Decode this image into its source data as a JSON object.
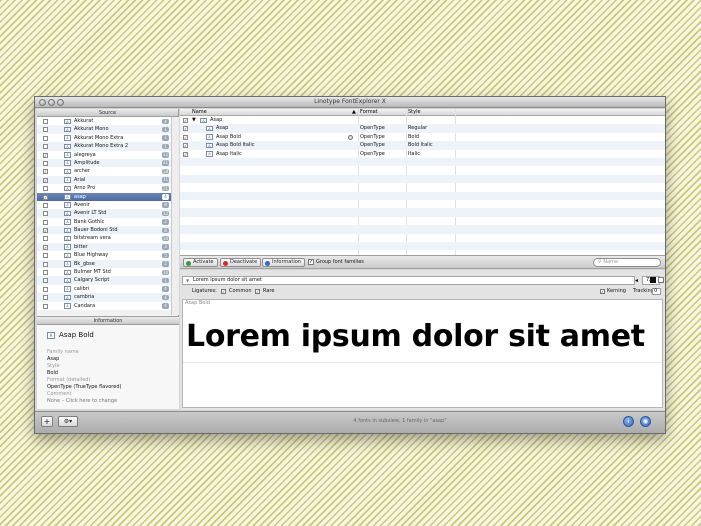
{
  "window": {
    "title": "Linotype FontExplorer X"
  },
  "sidebar": {
    "header": "Source",
    "fonts": [
      {
        "name": "Akkurat",
        "count": "4",
        "checked": false
      },
      {
        "name": "Akkurat Mono",
        "count": "1",
        "checked": false
      },
      {
        "name": "Akkurat Mono Extra",
        "count": "1",
        "checked": false
      },
      {
        "name": "Akkurat Mono Extra 2",
        "count": "1",
        "checked": false
      },
      {
        "name": "alegreya",
        "count": "12",
        "checked": true
      },
      {
        "name": "Amplitude",
        "count": "21",
        "checked": false
      },
      {
        "name": "archer",
        "count": "18",
        "checked": true
      },
      {
        "name": "Arial",
        "count": "11",
        "checked": true
      },
      {
        "name": "Arno Pro",
        "count": "21",
        "checked": false
      },
      {
        "name": "asap",
        "count": "4",
        "checked": true,
        "selected": true
      },
      {
        "name": "Avenir",
        "count": "8",
        "checked": false
      },
      {
        "name": "Avenir LT Std",
        "count": "12",
        "checked": false
      },
      {
        "name": "Bank Gothic",
        "count": "2",
        "checked": false
      },
      {
        "name": "Bauer Bodoni Std",
        "count": "8",
        "checked": true
      },
      {
        "name": "bitstream vera",
        "count": "10",
        "checked": false
      },
      {
        "name": "bitter",
        "count": "3",
        "checked": true
      },
      {
        "name": "Blue Highway",
        "count": "5",
        "checked": false
      },
      {
        "name": "Bk_gbse",
        "count": "2",
        "checked": false
      },
      {
        "name": "Bulmer MT Std",
        "count": "10",
        "checked": false
      },
      {
        "name": "Calgary Script",
        "count": "1",
        "checked": false
      },
      {
        "name": "calibri",
        "count": "4",
        "checked": false
      },
      {
        "name": "cambria",
        "count": "4",
        "checked": false
      },
      {
        "name": "Candara",
        "count": "4",
        "checked": false
      }
    ]
  },
  "information": {
    "header": "Information",
    "font_name": "Asap Bold",
    "family_label": "Family name",
    "family_value": "Asap",
    "style_label": "Style",
    "style_value": "Bold",
    "format_label": "Format (detailed)",
    "format_value": "OpenType (TrueType flavored)",
    "comment_label": "Comment",
    "comment_value": "None – Click here to change"
  },
  "grid": {
    "columns": {
      "name": "Name",
      "format": "Format",
      "style": "Style"
    },
    "family": "Asap",
    "rows": [
      {
        "name": "Asap",
        "format": "OpenType",
        "style": "Regular"
      },
      {
        "name": "Asap Bold",
        "format": "OpenType",
        "style": "Bold"
      },
      {
        "name": "Asap Bold Italic",
        "format": "OpenType",
        "style": "Bold Italic"
      },
      {
        "name": "Asap Italic",
        "format": "OpenType",
        "style": "Italic"
      }
    ]
  },
  "toolbar": {
    "activate": "Activate",
    "deactivate": "Deactivate",
    "information": "Information",
    "group_label": "Group font families",
    "search_placeholder": "Name"
  },
  "preview": {
    "sample_text": "Lorem ipsum dolor sit amet",
    "size": "72",
    "ligatures_label": "Ligatures:",
    "common_label": "Common",
    "rare_label": "Rare",
    "kerning_label": "Kerning",
    "tracking_label": "Tracking:",
    "tracking_value": "0",
    "font_label": "Asap Bold",
    "display_text": "Lorem ipsum dolor sit amet"
  },
  "statusbar": {
    "text": "4 fonts in subview, 1 family in \"asap\""
  },
  "colors": {
    "accent": "#4a6aa2",
    "activate": "#3a9a3a",
    "deactivate": "#c83030",
    "info": "#3469c0"
  }
}
